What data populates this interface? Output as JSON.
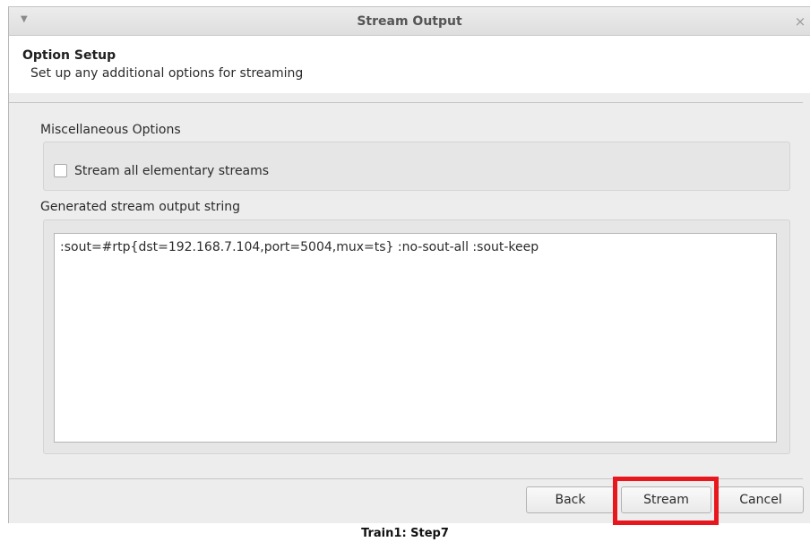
{
  "window": {
    "title": "Stream Output",
    "menu_icon": "chevron-down-icon",
    "close_icon": "close-icon"
  },
  "header": {
    "title": "Option Setup",
    "subtitle": "Set up any additional options for streaming"
  },
  "misc": {
    "label": "Miscellaneous Options",
    "checkbox_label": "Stream all elementary streams",
    "checkbox_checked": false
  },
  "output": {
    "label": "Generated stream output string",
    "value": ":sout=#rtp{dst=192.168.7.104,port=5004,mux=ts} :no-sout-all :sout-keep"
  },
  "buttons": {
    "back": "Back",
    "stream": "Stream",
    "cancel": "Cancel"
  },
  "highlight_color": "#e8171d",
  "caption": "Train1: Step7"
}
